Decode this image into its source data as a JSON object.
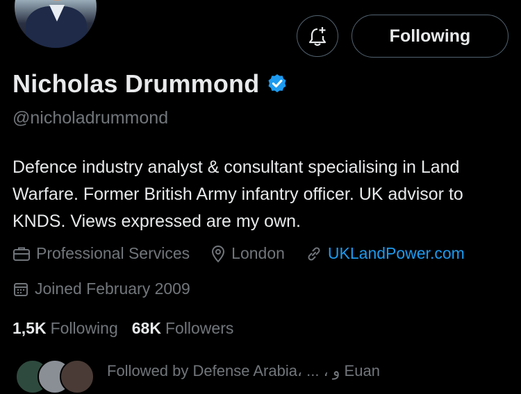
{
  "profile": {
    "name": "Nicholas Drummond",
    "handle": "@nicholadrummond",
    "bio": "Defence industry analyst & consultant specialising in Land Warfare. Former British Army infantry officer. UK advisor to KNDS. Views expressed are my own.",
    "category": "Professional Services",
    "location": "London",
    "website": "UKLandPower.com",
    "joined": "Joined February 2009",
    "verified": true
  },
  "actions": {
    "follow_label": "Following"
  },
  "stats": {
    "following_count": "1,5K",
    "following_label": "Following",
    "followers_count": "68K",
    "followers_label": "Followers"
  },
  "followed_by": {
    "text": "Followed by Defense Arabia، ... ، و Euan"
  },
  "colors": {
    "background": "#000000",
    "primary_text": "#e7e9ea",
    "secondary_text": "#71767b",
    "link": "#1d9bf0",
    "verified_badge": "#1d9bf0",
    "button_border": "#536471"
  },
  "icons": {
    "verified": "verified-badge-icon",
    "bell": "bell-plus-icon",
    "category": "briefcase-icon",
    "location": "location-pin-icon",
    "website": "link-icon",
    "joined": "calendar-icon"
  }
}
